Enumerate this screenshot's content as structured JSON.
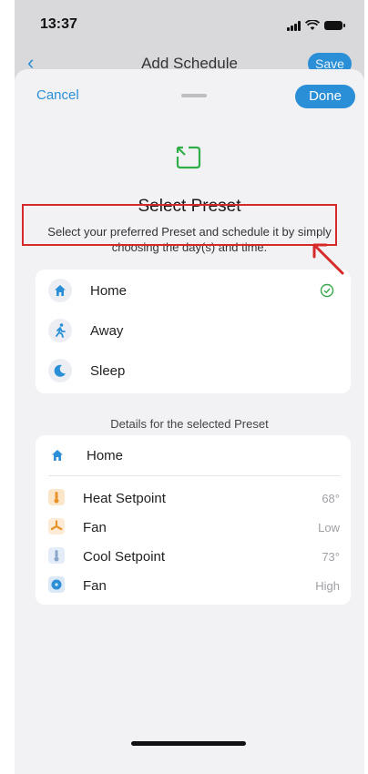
{
  "status_bar": {
    "time": "13:37"
  },
  "background_header": {
    "title": "Add Schedule",
    "save_label": "Save"
  },
  "sheet": {
    "cancel_label": "Cancel",
    "done_label": "Done",
    "title": "Select Preset",
    "description": "Select your preferred Preset and schedule it by simply choosing the day(s) and time.",
    "presets": [
      {
        "label": "Home",
        "icon": "home-icon",
        "selected": true
      },
      {
        "label": "Away",
        "icon": "walking-person-icon",
        "selected": false
      },
      {
        "label": "Sleep",
        "icon": "moon-icon",
        "selected": false
      }
    ],
    "details_label": "Details for the selected Preset",
    "details": {
      "preset_name": "Home",
      "rows": [
        {
          "label": "Heat Setpoint",
          "value": "68°",
          "icon": "thermometer-icon"
        },
        {
          "label": "Fan",
          "value": "Low",
          "icon": "fan-icon"
        },
        {
          "label": "Cool Setpoint",
          "value": "73°",
          "icon": "thermometer-icon"
        },
        {
          "label": "Fan",
          "value": "High",
          "icon": "fan-high-icon"
        }
      ]
    }
  },
  "colors": {
    "accent": "#2a8fd6",
    "highlight": "#d62a2a",
    "selected_check": "#3aa84a"
  }
}
